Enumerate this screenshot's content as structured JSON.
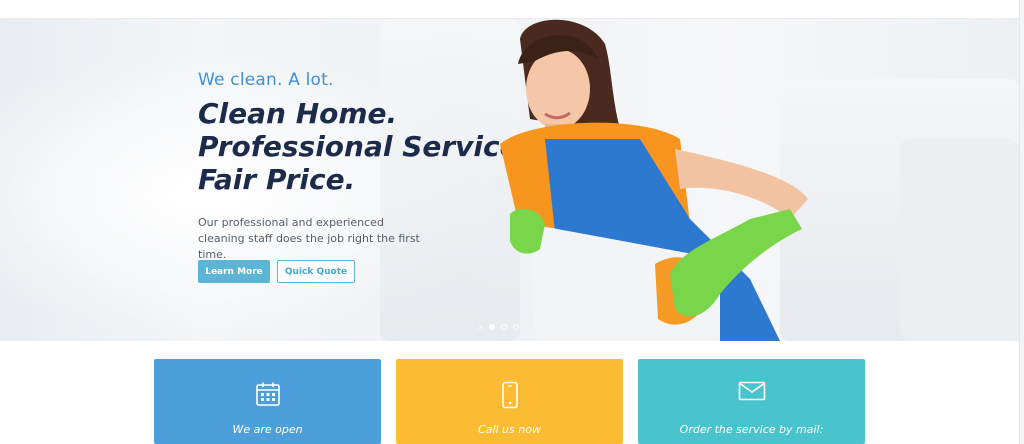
{
  "hero": {
    "tagline": "We clean. A lot.",
    "headline": [
      "Clean Home.",
      "Professional Service.",
      "Fair Price."
    ],
    "description": "Our professional and experienced cleaning staff does the job right the first time.",
    "learn_more_label": "Learn More",
    "quick_quote_label": "Quick Quote",
    "slides_total": 3,
    "active_slide": 1
  },
  "cards": [
    {
      "label": "We are open",
      "icon": "calendar-icon",
      "color": "#4d9fdc"
    },
    {
      "label": "Call us now",
      "icon": "phone-icon",
      "color": "#fbbb33"
    },
    {
      "label": "Order the service by mail:",
      "icon": "envelope-icon",
      "color": "#49c4cc"
    }
  ],
  "colors": {
    "accent": "#5bb6d6",
    "tagline": "#3f8fd6",
    "headline": "#1d2b4a"
  }
}
